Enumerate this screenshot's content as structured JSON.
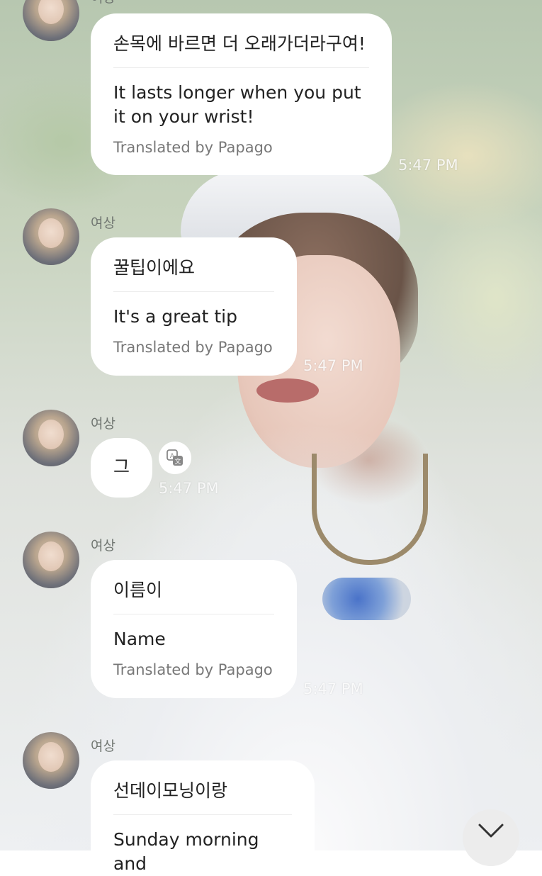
{
  "messages": [
    {
      "sender": "여상",
      "original": "손목에 바르면 더 오래가더라구여!",
      "translation": "It lasts longer when you put it on your wrist!",
      "credit": "Translated by Papago",
      "time": "5:47 PM"
    },
    {
      "sender": "여상",
      "original": "꿀팁이에요",
      "translation": "It's a great tip",
      "credit": "Translated by Papago",
      "time": "5:47 PM"
    },
    {
      "sender": "여상",
      "original": "그",
      "time": "5:47 PM",
      "translate_icon": "translate-icon"
    },
    {
      "sender": "여상",
      "original": "이름이",
      "translation": "Name",
      "credit": "Translated by Papago",
      "time": "5:47 PM"
    },
    {
      "sender": "여상",
      "original": "선데이모닝이랑",
      "translation": "Sunday morning and"
    }
  ],
  "scroll_button": {
    "icon": "chevron-down-icon"
  }
}
